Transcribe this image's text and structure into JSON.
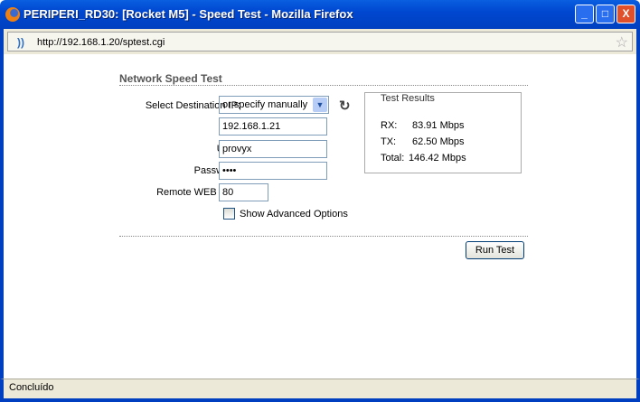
{
  "window": {
    "title": "PERIPERI_RD30: [Rocket M5] - Speed Test - Mozilla Firefox",
    "url": "http://192.168.1.20/sptest.cgi",
    "minimize": "_",
    "maximize": "□",
    "close": "X"
  },
  "page": {
    "heading": "Network Speed Test",
    "dest_label": "Select Destination IP:",
    "dest_value": "or specify manually",
    "ip_value": "192.168.1.21",
    "user_label": "User:",
    "user_value": "provyx",
    "password_label": "Password:",
    "password_value": "••••",
    "port_label": "Remote WEB Port:",
    "port_value": "80",
    "advanced_label": "Show Advanced Options",
    "run_button": "Run Test"
  },
  "results": {
    "legend": "Test Results",
    "rx_label": "RX:",
    "rx_value": "83.91 Mbps",
    "tx_label": "TX:",
    "tx_value": "62.50 Mbps",
    "total_label": "Total:",
    "total_value": "146.42 Mbps"
  },
  "status": "Concluído"
}
